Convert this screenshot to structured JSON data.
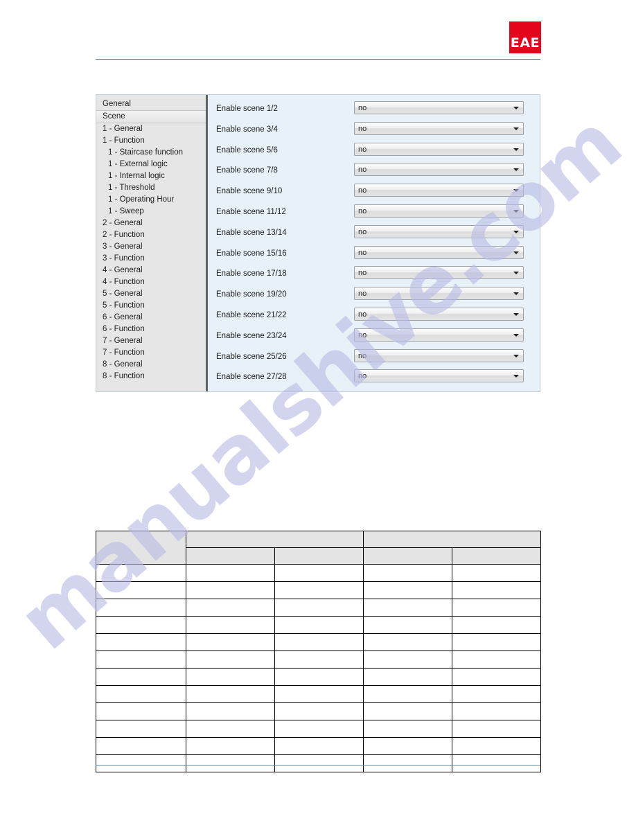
{
  "page": {
    "background_color": "#ffffff",
    "rule_color": "#4d6f80"
  },
  "watermark": {
    "text": "manualshive.com",
    "color": "#b9bce6"
  },
  "header": {
    "logo_text": "EAE",
    "logo_color": "#e3051b"
  },
  "ets_window": {
    "tree": {
      "selected": "Scene",
      "items": [
        {
          "label": "General",
          "indent": 0,
          "selected": false
        },
        {
          "label": "Scene",
          "indent": 0,
          "selected": true
        },
        {
          "label": "1 - General",
          "indent": 0,
          "selected": false
        },
        {
          "label": "1 - Function",
          "indent": 0,
          "selected": false
        },
        {
          "label": "1 - Staircase function",
          "indent": 1,
          "selected": false
        },
        {
          "label": "1 - External logic",
          "indent": 1,
          "selected": false
        },
        {
          "label": "1 - Internal logic",
          "indent": 1,
          "selected": false
        },
        {
          "label": "1 - Threshold",
          "indent": 1,
          "selected": false
        },
        {
          "label": "1 - Operating Hour",
          "indent": 1,
          "selected": false
        },
        {
          "label": "1 - Sweep",
          "indent": 1,
          "selected": false
        },
        {
          "label": "2 - General",
          "indent": 0,
          "selected": false
        },
        {
          "label": "2 - Function",
          "indent": 0,
          "selected": false
        },
        {
          "label": "3 - General",
          "indent": 0,
          "selected": false
        },
        {
          "label": "3 - Function",
          "indent": 0,
          "selected": false
        },
        {
          "label": "4 - General",
          "indent": 0,
          "selected": false
        },
        {
          "label": "4 - Function",
          "indent": 0,
          "selected": false
        },
        {
          "label": "5 - General",
          "indent": 0,
          "selected": false
        },
        {
          "label": "5 - Function",
          "indent": 0,
          "selected": false
        },
        {
          "label": "6 - General",
          "indent": 0,
          "selected": false
        },
        {
          "label": "6 - Function",
          "indent": 0,
          "selected": false
        },
        {
          "label": "7 - General",
          "indent": 0,
          "selected": false
        },
        {
          "label": "7 - Function",
          "indent": 0,
          "selected": false
        },
        {
          "label": "8 - General",
          "indent": 0,
          "selected": false
        },
        {
          "label": "8 - Function",
          "indent": 0,
          "selected": false
        }
      ]
    },
    "parameters": [
      {
        "label": "Enable scene 1/2",
        "value": "no"
      },
      {
        "label": "Enable scene 3/4",
        "value": "no"
      },
      {
        "label": "Enable scene 5/6",
        "value": "no"
      },
      {
        "label": "Enable scene 7/8",
        "value": "no"
      },
      {
        "label": "Enable scene 9/10",
        "value": "no"
      },
      {
        "label": "Enable scene 11/12",
        "value": "no"
      },
      {
        "label": "Enable scene 13/14",
        "value": "no"
      },
      {
        "label": "Enable scene 15/16",
        "value": "no"
      },
      {
        "label": "Enable scene 17/18",
        "value": "no"
      },
      {
        "label": "Enable scene 19/20",
        "value": "no"
      },
      {
        "label": "Enable scene 21/22",
        "value": "no"
      },
      {
        "label": "Enable scene 23/24",
        "value": "no"
      },
      {
        "label": "Enable scene 25/26",
        "value": "no"
      },
      {
        "label": "Enable scene 27/28",
        "value": "no"
      }
    ]
  },
  "spec_table": {
    "header_top": [
      "",
      "",
      ""
    ],
    "header_bottom": [
      "",
      "",
      "",
      "",
      ""
    ],
    "rows": [
      [
        "",
        "",
        "",
        "",
        ""
      ],
      [
        "",
        "",
        "",
        "",
        ""
      ],
      [
        "",
        "",
        "",
        "",
        ""
      ],
      [
        "",
        "",
        "",
        "",
        ""
      ],
      [
        "",
        "",
        "",
        "",
        ""
      ],
      [
        "",
        "",
        "",
        "",
        ""
      ],
      [
        "",
        "",
        "",
        "",
        ""
      ],
      [
        "",
        "",
        "",
        "",
        ""
      ],
      [
        "",
        "",
        "",
        "",
        ""
      ],
      [
        "",
        "",
        "",
        "",
        ""
      ],
      [
        "",
        "",
        "",
        "",
        ""
      ],
      [
        "",
        "",
        "",
        "",
        ""
      ]
    ]
  }
}
